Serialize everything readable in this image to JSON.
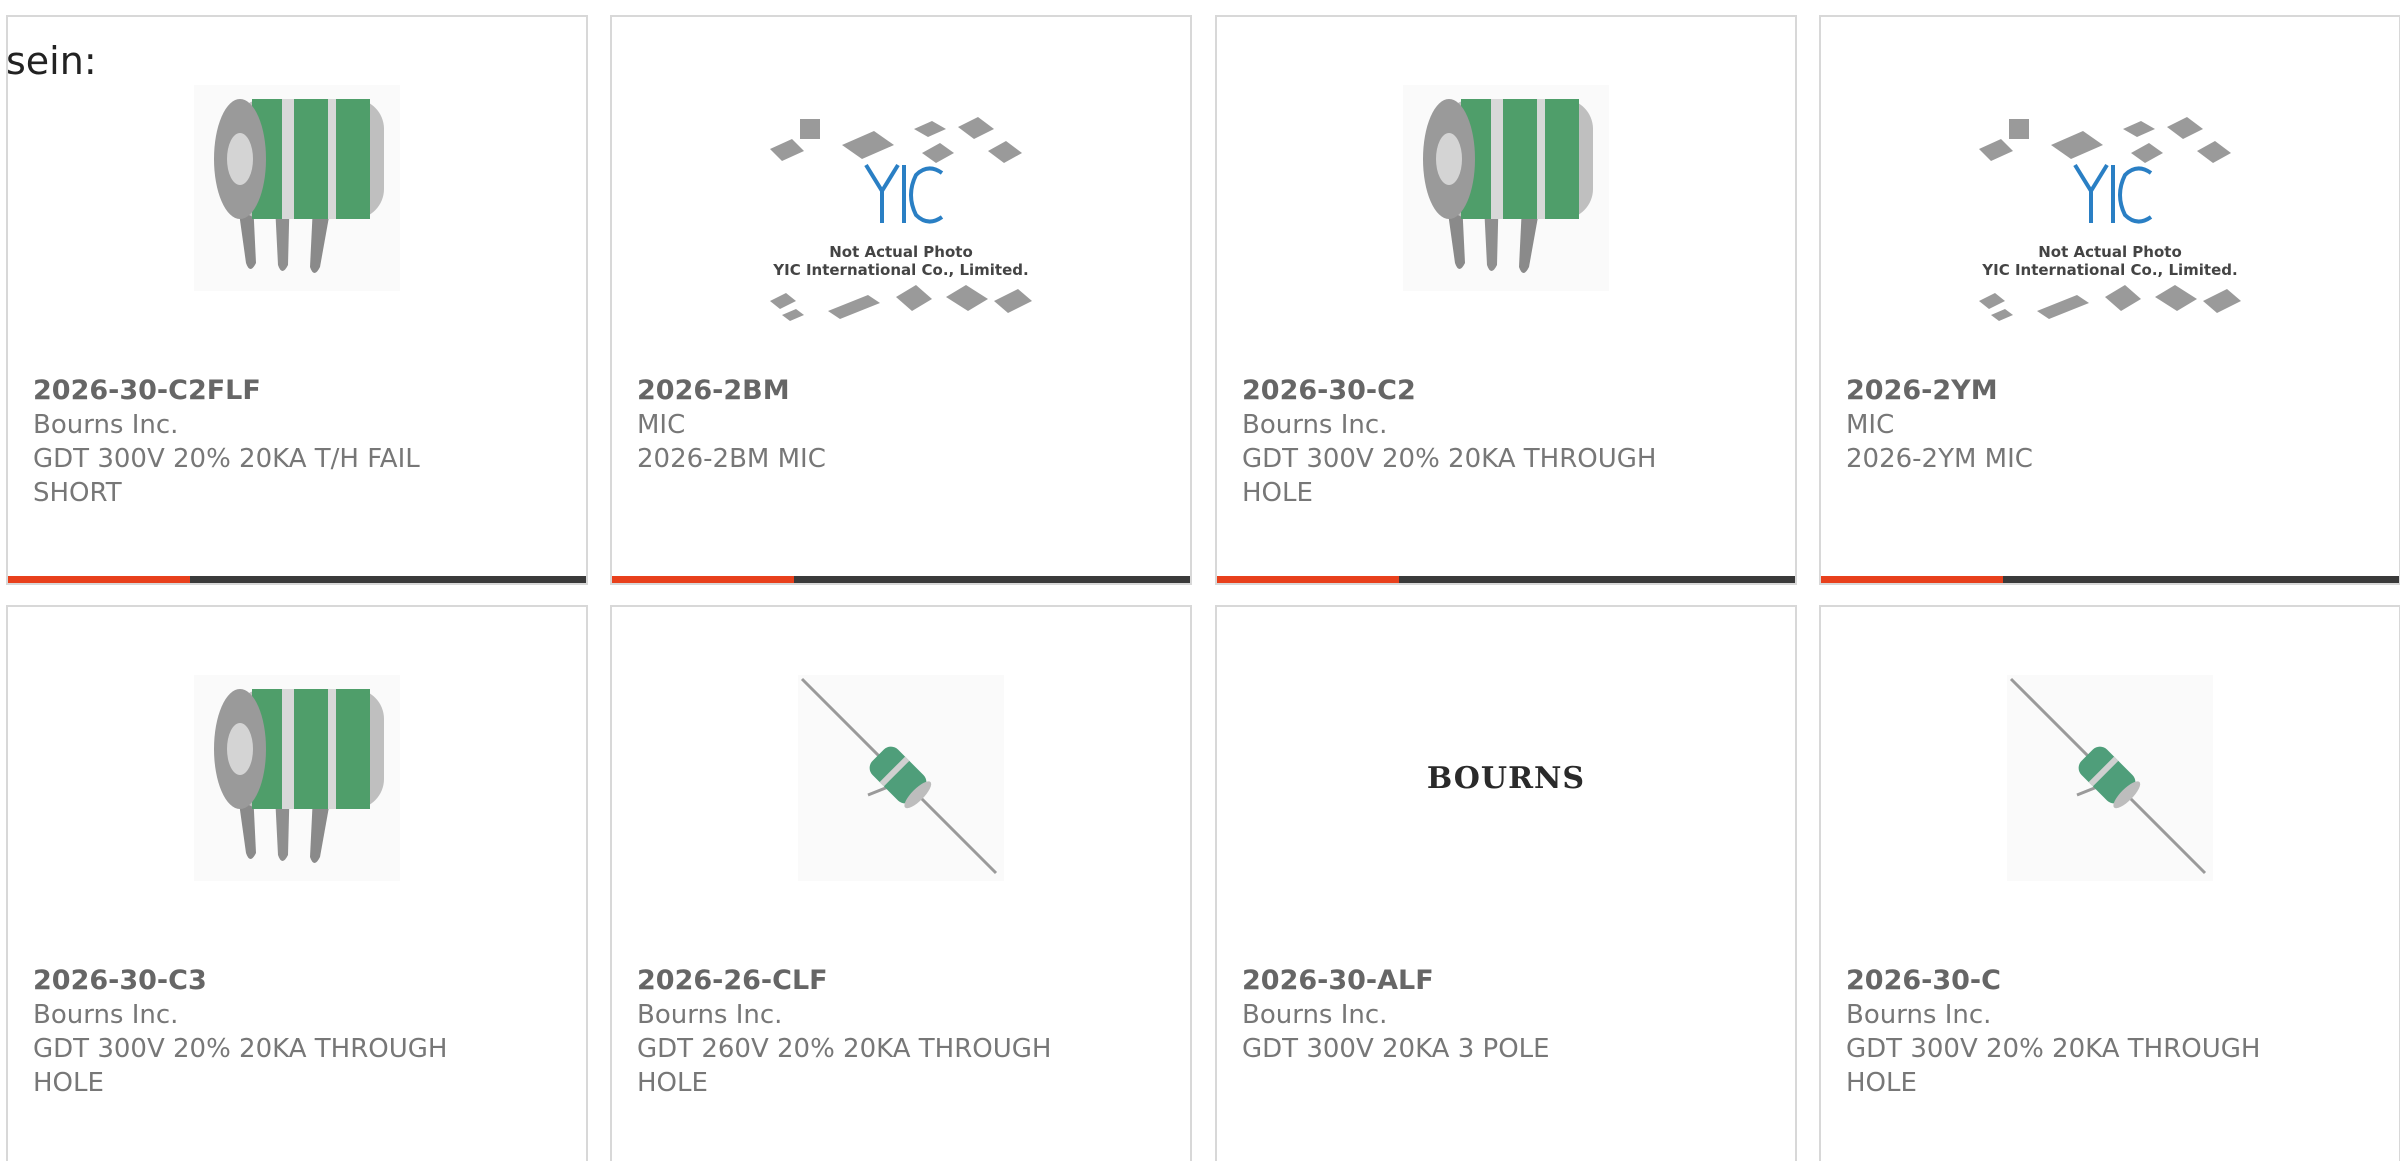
{
  "intro": {
    "text": "sein:"
  },
  "colors": {
    "accent": "#e8401c",
    "bar": "#3a3a3a",
    "border": "#d8d8d8",
    "text": "#666666"
  },
  "products": [
    {
      "part_number": "2026-30-C2FLF",
      "manufacturer": "Bourns Inc.",
      "description": "GDT 300V 20% 20KA T/H FAIL SHORT",
      "image": "gdt-3-pole-icon",
      "selected": true
    },
    {
      "part_number": "2026-2BM",
      "manufacturer": "MIC",
      "description": "2026-2BM MIC",
      "image": "not-actual-photo-icon",
      "image_caption_1": "Not Actual Photo",
      "image_caption_2": "YIC International Co., Limited.",
      "selected": true
    },
    {
      "part_number": "2026-30-C2",
      "manufacturer": "Bourns Inc.",
      "description": "GDT 300V 20% 20KA THROUGH HOLE",
      "image": "gdt-3-pole-icon",
      "selected": true
    },
    {
      "part_number": "2026-2YM",
      "manufacturer": "MIC",
      "description": "2026-2YM MIC",
      "image": "not-actual-photo-icon",
      "image_caption_1": "Not Actual Photo",
      "image_caption_2": "YIC International Co., Limited.",
      "selected": true
    },
    {
      "part_number": "2026-30-C3",
      "manufacturer": "Bourns Inc.",
      "description": "GDT 300V 20% 20KA THROUGH HOLE",
      "image": "gdt-3-pole-icon",
      "selected": false
    },
    {
      "part_number": "2026-26-CLF",
      "manufacturer": "Bourns Inc.",
      "description": "GDT 260V 20% 20KA THROUGH HOLE",
      "image": "gdt-axial-icon",
      "selected": false
    },
    {
      "part_number": "2026-30-ALF",
      "manufacturer": "Bourns Inc.",
      "description": "GDT 300V 20KA 3 POLE",
      "image": "bourns-logo",
      "image_text": "BOURNS",
      "selected": false
    },
    {
      "part_number": "2026-30-C",
      "manufacturer": "Bourns Inc.",
      "description": "GDT 300V 20% 20KA THROUGH HOLE",
      "image": "gdt-axial-icon",
      "selected": false
    }
  ]
}
